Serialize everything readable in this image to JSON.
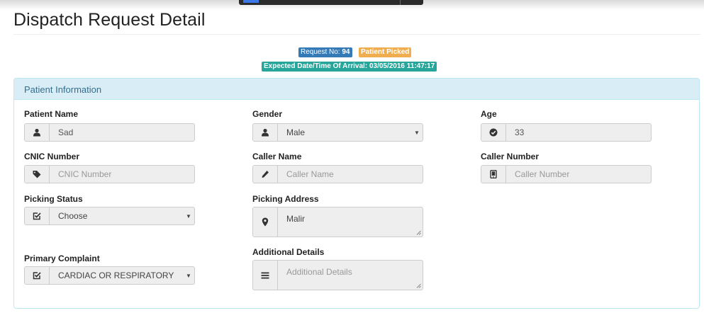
{
  "page": {
    "title": "Dispatch Request Detail"
  },
  "badges": {
    "request_label": "Request No:",
    "request_no": "94",
    "status": "Patient Picked",
    "eta": "Expected Date/Time Of Arrival: 03/05/2016 11:47:17"
  },
  "colors": {
    "request_badge": "#337ab7",
    "status_badge": "#f0ad4e",
    "eta_badge": "#26a69a",
    "panel_heading": "#d9edf7"
  },
  "panel": {
    "title": "Patient Information"
  },
  "fields": {
    "patient_name": {
      "label": "Patient Name",
      "value": "Sad",
      "icon": "user-icon"
    },
    "gender": {
      "label": "Gender",
      "value": "Male",
      "icon": "user-icon"
    },
    "age": {
      "label": "Age",
      "value": "33",
      "icon": "check-circle-icon"
    },
    "cnic": {
      "label": "CNIC Number",
      "placeholder": "CNIC Number",
      "icon": "tag-icon"
    },
    "caller_name": {
      "label": "Caller Name",
      "placeholder": "Caller Name",
      "icon": "pencil-icon"
    },
    "caller_number": {
      "label": "Caller Number",
      "placeholder": "Caller Number",
      "icon": "phone-icon"
    },
    "picking_status": {
      "label": "Picking Status",
      "value": "Choose",
      "icon": "checkbox-icon"
    },
    "picking_address": {
      "label": "Picking Address",
      "value": "Malir",
      "icon": "map-marker-icon"
    },
    "primary_complaint": {
      "label": "Primary Complaint",
      "value": "CARDIAC OR RESPIRATORY",
      "icon": "checkbox-icon"
    },
    "additional_details": {
      "label": "Additional Details",
      "placeholder": "Additional Details",
      "icon": "list-icon"
    }
  }
}
